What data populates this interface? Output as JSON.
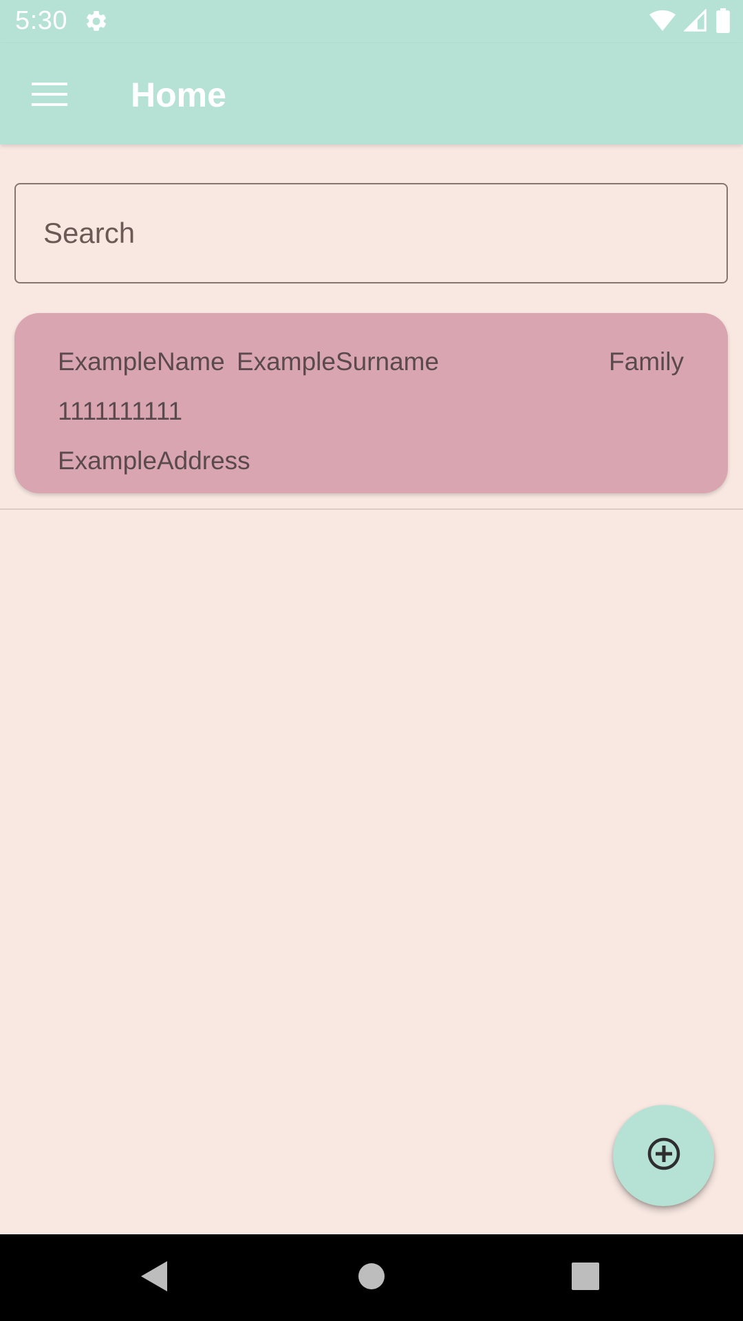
{
  "status_bar": {
    "time": "5:30",
    "icons": [
      "gear-icon",
      "wifi-icon",
      "signal-icon",
      "battery-icon"
    ]
  },
  "app_bar": {
    "title": "Home",
    "menu_icon": "hamburger-menu-icon"
  },
  "search": {
    "placeholder": "Search",
    "value": ""
  },
  "contacts": [
    {
      "name": "ExampleName",
      "surname": "ExampleSurname",
      "group": "Family",
      "phone": "1111111111",
      "address": "ExampleAddress"
    }
  ],
  "fab": {
    "icon": "add-circle-icon"
  },
  "nav_bar": {
    "icons": [
      "back-icon",
      "home-icon",
      "recents-icon"
    ]
  },
  "colors": {
    "primary": "#b5e2d5",
    "background": "#f9e8e2",
    "card": "#d8a5b1",
    "card_text": "#5b4a4d"
  }
}
